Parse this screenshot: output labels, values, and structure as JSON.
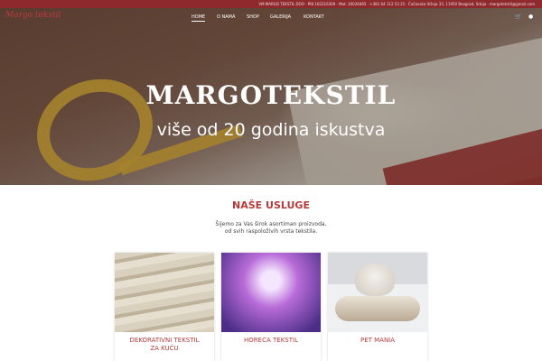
{
  "topbar": {
    "info": "VM MARGO TEKSTIL DOO · PIB 102216309 · Mat. 20026465 · +381 64 112 53 25 · Čačanska Višnja 33, 11050 Beograd, Srbija · margotekstil@gmail.com"
  },
  "logo": {
    "text": "Margo tekstil"
  },
  "nav": {
    "items": [
      "HOME",
      "O NAMA",
      "SHOP",
      "GALERIJA",
      "KONTAKT"
    ],
    "active": "HOME"
  },
  "icons": {
    "cart": "shopping-cart-icon",
    "user": "user-icon"
  },
  "hero": {
    "title": "MARGOTEKSTIL",
    "subtitle": "više od 20 godina iskustva"
  },
  "services": {
    "title": "NAŠE USLUGE",
    "intro_line1": "Šijemo za Vas širok asortiman proizvoda,",
    "intro_line2": "od svih raspoloživih vrsta tekstila."
  },
  "cards": [
    {
      "label_line1": "DEKORATIVNI TEKSTIL",
      "label_line2": "ZA KUĆU"
    },
    {
      "label_line1": "HORECA TEKSTIL",
      "label_line2": ""
    },
    {
      "label_line1": "PET MANIA",
      "label_line2": ""
    }
  ],
  "colors": {
    "brand": "#8e2a2d",
    "accent": "#b53a3a"
  }
}
